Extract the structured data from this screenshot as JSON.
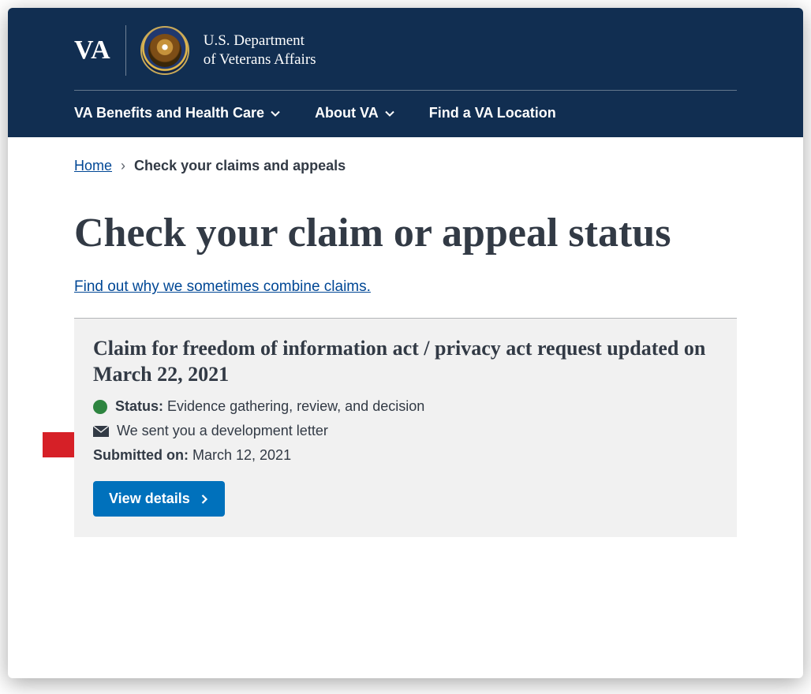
{
  "header": {
    "logo_text": "VA",
    "dept_line1": "U.S. Department",
    "dept_line2": "of Veterans Affairs",
    "nav": [
      {
        "label": "VA Benefits and Health Care",
        "has_chevron": true
      },
      {
        "label": "About VA",
        "has_chevron": true
      },
      {
        "label": "Find a VA Location",
        "has_chevron": false
      }
    ]
  },
  "breadcrumb": {
    "home": "Home",
    "current": "Check your claims and appeals"
  },
  "page_title": "Check your claim or appeal status",
  "combine_link": "Find out why we sometimes combine claims.",
  "claim": {
    "title": "Claim for freedom of information act / privacy act request updated on March 22, 2021",
    "status_label": "Status:",
    "status_value": "Evidence gathering, review, and decision",
    "status_color": "#2e8540",
    "mail_text": "We sent you a development letter",
    "submitted_label": "Submitted on:",
    "submitted_value": "March 12, 2021",
    "button": "View details"
  }
}
